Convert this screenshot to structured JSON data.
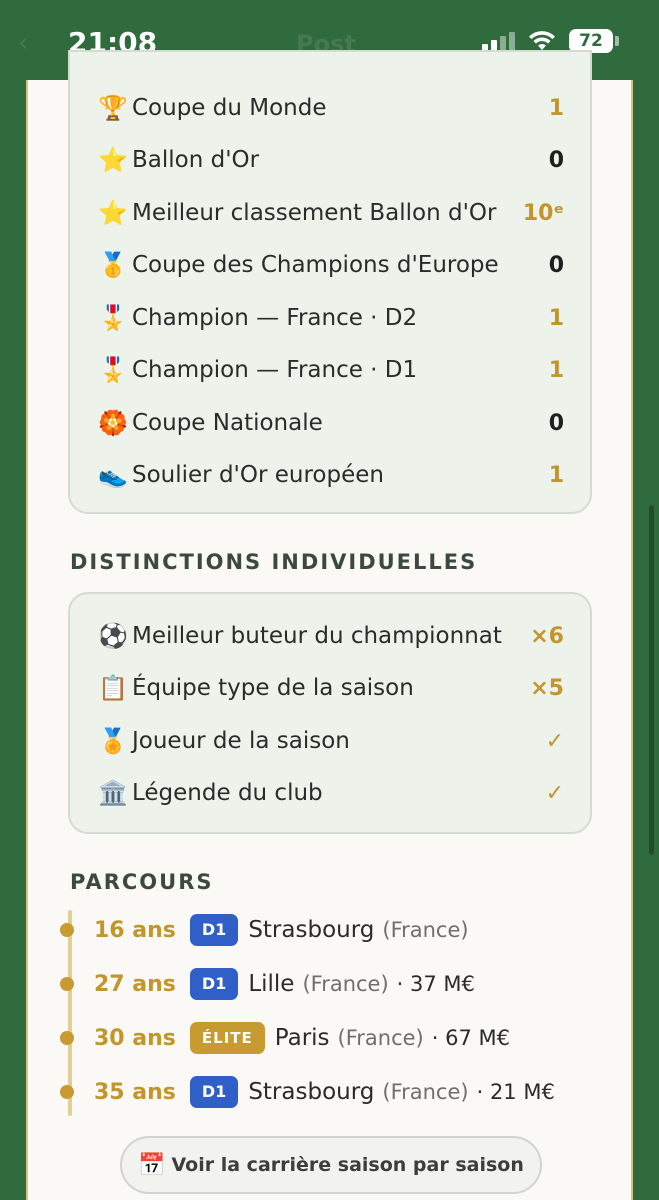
{
  "status_bar": {
    "time": "21:08",
    "ghost_title": "Post",
    "battery": "72"
  },
  "trophies": [
    {
      "icon": "🏆",
      "label": "Coupe du Monde",
      "value": "1",
      "tone": "gold"
    },
    {
      "icon": "⭐",
      "label": "Ballon d'Or",
      "value": "0",
      "tone": "dark"
    },
    {
      "icon": "⭐",
      "label": "Meilleur classement Ballon d'Or",
      "value": "10ᵉ",
      "tone": "gold"
    },
    {
      "icon": "🥇",
      "label": "Coupe des Champions d'Europe",
      "value": "0",
      "tone": "dark"
    },
    {
      "icon": "🎖️",
      "label": "Champion — France · D2",
      "value": "1",
      "tone": "gold"
    },
    {
      "icon": "🎖️",
      "label": "Champion — France · D1",
      "value": "1",
      "tone": "gold"
    },
    {
      "icon": "🏵️",
      "label": "Coupe Nationale",
      "value": "0",
      "tone": "dark"
    },
    {
      "icon": "👟",
      "label": "Soulier d'Or européen",
      "value": "1",
      "tone": "gold"
    }
  ],
  "distinctions": {
    "title": "DISTINCTIONS INDIVIDUELLES",
    "items": [
      {
        "icon": "⚽",
        "label": "Meilleur buteur du championnat",
        "value": "×6"
      },
      {
        "icon": "📋",
        "label": "Équipe type de la saison",
        "value": "×5"
      },
      {
        "icon": "🏅",
        "label": "Joueur de la saison",
        "value": "✓"
      },
      {
        "icon": "🏛️",
        "label": "Légende du club",
        "value": "✓"
      }
    ]
  },
  "parcours": {
    "title": "PARCOURS",
    "items": [
      {
        "age": "16 ans",
        "league": "D1",
        "club": "Strasbourg",
        "country": "(France)",
        "fee": ""
      },
      {
        "age": "27 ans",
        "league": "D1",
        "club": "Lille",
        "country": "(France)",
        "fee": "· 37 M€"
      },
      {
        "age": "30 ans",
        "league": "ÉLITE",
        "club": "Paris",
        "country": "(France)",
        "fee": "· 67 M€"
      },
      {
        "age": "35 ans",
        "league": "D1",
        "club": "Strasbourg",
        "country": "(France)",
        "fee": "· 21 M€"
      }
    ]
  },
  "career_button": {
    "icon": "📅",
    "label": "Voir la carrière saison par saison"
  },
  "colors": {
    "app_green": "#2f6b3d",
    "gold": "#c2962b",
    "d1_badge": "#2f5fc7",
    "elite_badge": "#c79a32"
  }
}
